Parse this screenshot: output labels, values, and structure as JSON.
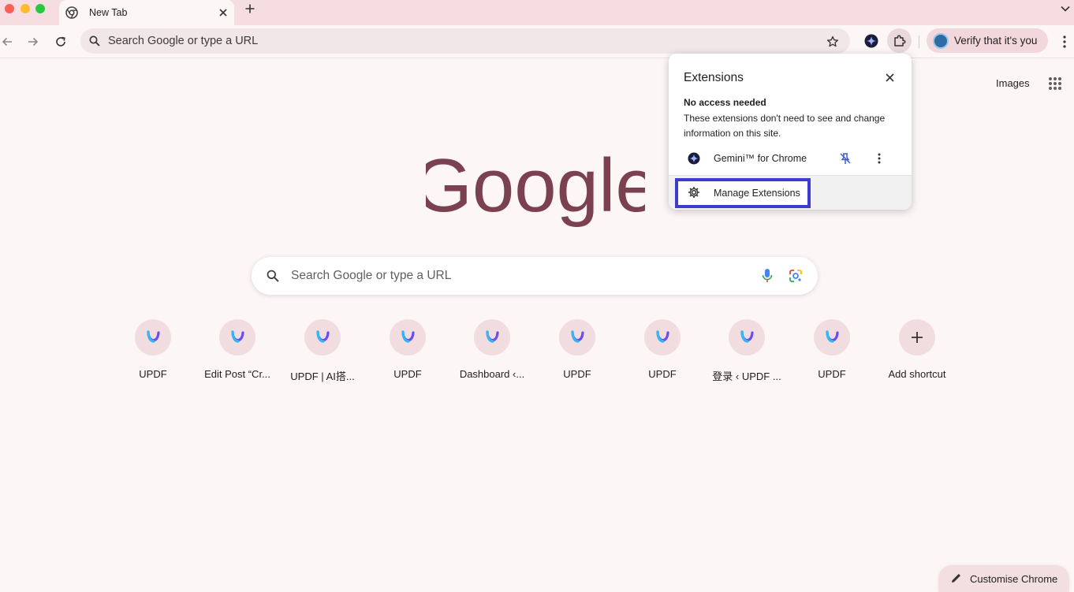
{
  "tab": {
    "title": "New Tab"
  },
  "omnibox": {
    "placeholder": "Search Google or type a URL"
  },
  "profile": {
    "verify_text": "Verify that it's you"
  },
  "ntp": {
    "images_link": "Images",
    "logo_text": "Google",
    "search_placeholder": "Search Google or type a URL",
    "shortcuts": [
      {
        "label": "UPDF",
        "icon": "updf-icon"
      },
      {
        "label": "Edit Post “Cr...",
        "icon": "updf-icon"
      },
      {
        "label": "UPDF | AI搭...",
        "icon": "updf-icon"
      },
      {
        "label": "UPDF",
        "icon": "updf-icon"
      },
      {
        "label": "Dashboard ‹...",
        "icon": "updf-icon"
      },
      {
        "label": "UPDF",
        "icon": "updf-icon"
      },
      {
        "label": "UPDF",
        "icon": "updf-icon"
      },
      {
        "label": "登录 ‹ UPDF ...",
        "icon": "updf-icon"
      },
      {
        "label": "UPDF",
        "icon": "updf-icon"
      },
      {
        "label": "Add shortcut",
        "icon": "plus-icon"
      }
    ],
    "customise_label": "Customise Chrome"
  },
  "extensions_popup": {
    "title": "Extensions",
    "section_title": "No access needed",
    "section_desc": "These extensions don't need to see and change information on this site.",
    "items": [
      {
        "name": "Gemini™ for Chrome",
        "icon": "gemini-icon",
        "pinned": true
      }
    ],
    "manage_label": "Manage Extensions"
  },
  "colors": {
    "tabstrip": "#f6dde2",
    "page_bg": "#fcf6f6",
    "logo": "#7c4150",
    "highlight": "#3f3bd0"
  }
}
